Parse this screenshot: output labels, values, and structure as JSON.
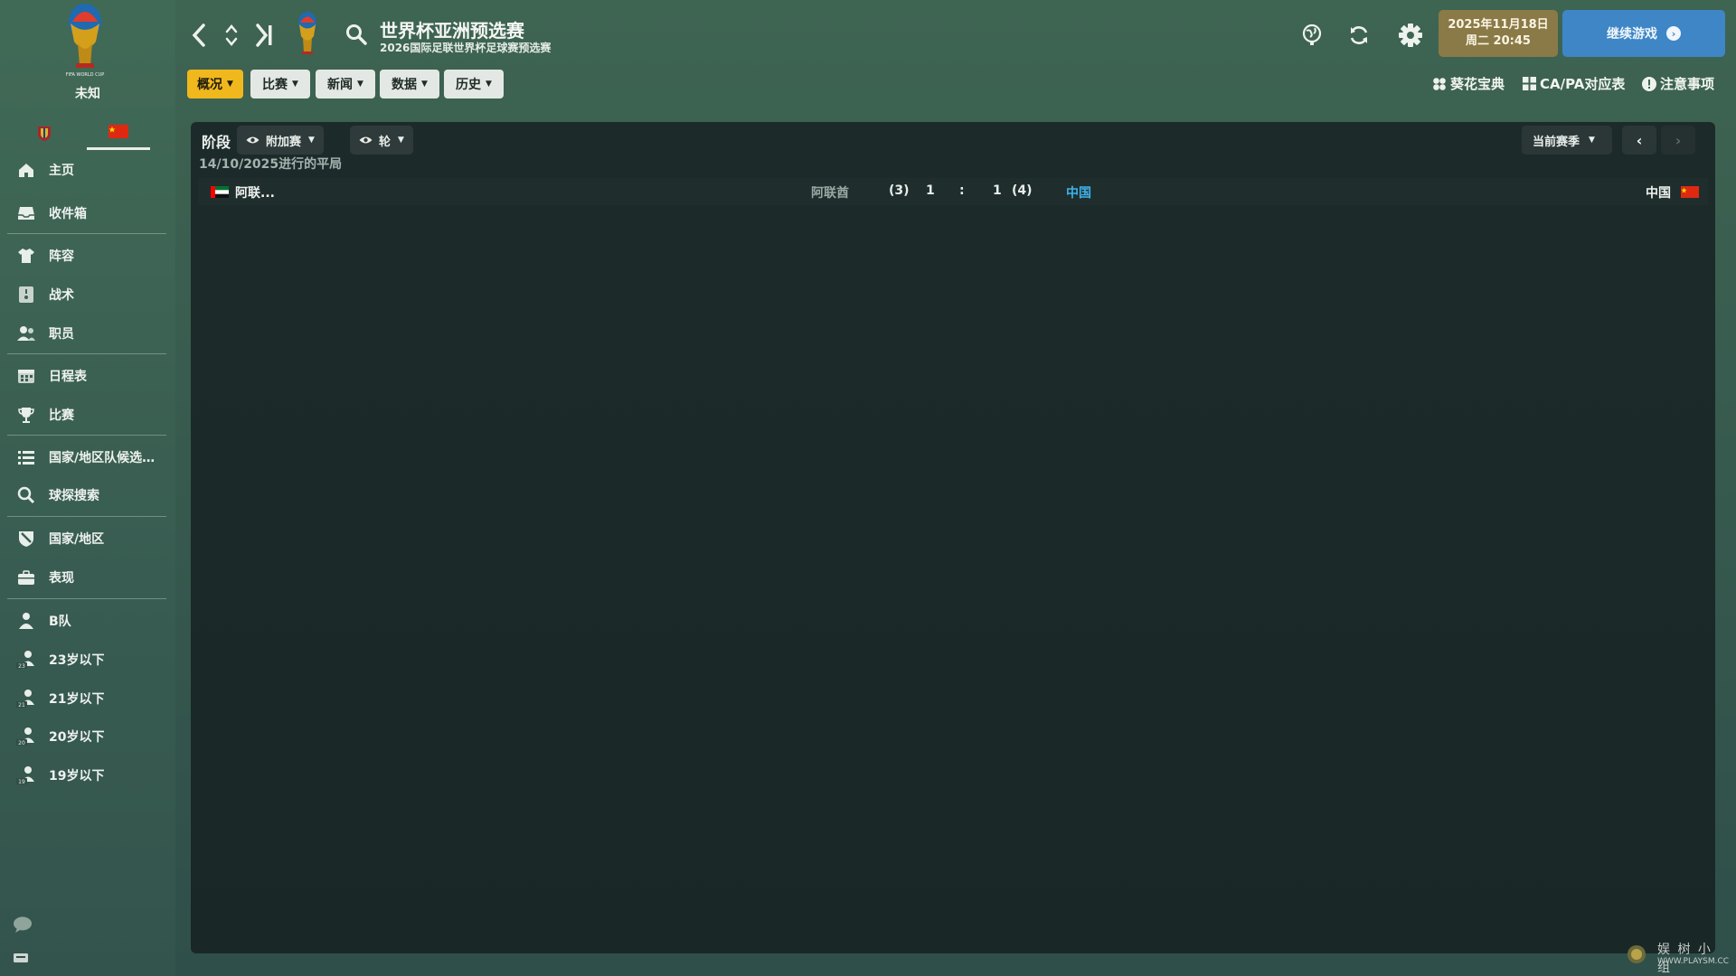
{
  "sidebar": {
    "club_caption": "未知",
    "items": [
      {
        "label": "主页",
        "icon": "home-icon"
      },
      {
        "label": "收件箱",
        "icon": "inbox-icon"
      },
      {
        "label": "阵容",
        "icon": "shirt-icon"
      },
      {
        "label": "战术",
        "icon": "tactics-board-icon"
      },
      {
        "label": "职员",
        "icon": "staff-icon"
      },
      {
        "label": "日程表",
        "icon": "calendar-icon"
      },
      {
        "label": "比赛",
        "icon": "trophy-icon"
      },
      {
        "label": "国家/地区队候选名...",
        "icon": "list-icon"
      },
      {
        "label": "球探搜索",
        "icon": "search-icon"
      },
      {
        "label": "国家/地区",
        "icon": "shield-icon"
      },
      {
        "label": "表现",
        "icon": "briefcase-icon"
      },
      {
        "label": "B队",
        "icon": "team-icon"
      },
      {
        "label": "23岁以下",
        "icon": "u23-team-icon"
      },
      {
        "label": "21岁以下",
        "icon": "u21-team-icon"
      },
      {
        "label": "20岁以下",
        "icon": "u20-team-icon"
      },
      {
        "label": "19岁以下",
        "icon": "u19-team-icon"
      }
    ]
  },
  "header": {
    "title": "世界杯亚洲预选赛",
    "subtitle": "2026国际足联世界杯足球赛预选赛",
    "date_line1": "2025年11月18日",
    "date_line2": "周二 20:45",
    "continue_label": "继续游戏",
    "tabs": [
      {
        "label": "概况",
        "active": true
      },
      {
        "label": "比赛",
        "active": false
      },
      {
        "label": "新闻",
        "active": false
      },
      {
        "label": "数据",
        "active": false
      },
      {
        "label": "历史",
        "active": false
      }
    ],
    "quick_links": [
      "葵花宝典",
      "CA/PA对应表",
      "注意事项"
    ]
  },
  "panel": {
    "stage_label": "阶段",
    "filter_stage": "附加赛",
    "filter_round": "轮",
    "season_label": "当前赛季",
    "date_caption": "14/10/2025进行的平局",
    "match": {
      "home_short": "阿联...",
      "home_full": "阿联酋",
      "home_pens": "(3)",
      "home_score": "1",
      "separator": ":",
      "away_score": "1",
      "away_pens": "(4)",
      "away_full": "中国",
      "away_short": "中国"
    }
  },
  "watermark": {
    "text_cn": "娱 树 小 组",
    "text_en": "WWW.PLAYSM.CC"
  },
  "colors": {
    "accent_tab": "#f0b81d",
    "continue_button": "#3e86c6",
    "date_box": "#8a7a47",
    "highlight_team": "#3fb2ea"
  }
}
